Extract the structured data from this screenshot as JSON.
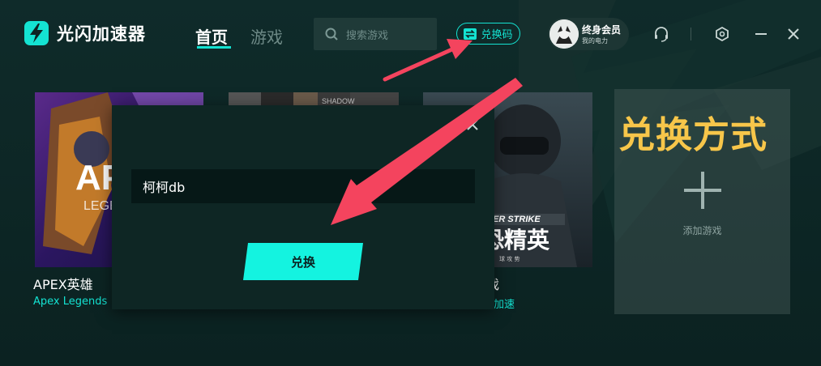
{
  "app": {
    "name": "光闪加速器"
  },
  "nav": {
    "tabs": [
      {
        "label": "首页",
        "active": true
      },
      {
        "label": "游戏",
        "active": false
      }
    ]
  },
  "search": {
    "placeholder": "搜索游戏"
  },
  "redeem": {
    "label": "兑换码"
  },
  "member": {
    "title": "终身会员",
    "subtitle": "我的电力"
  },
  "window_controls": [
    "headset-icon",
    "settings-icon",
    "minimize-icon",
    "close-icon"
  ],
  "games": [
    {
      "title": "APEX英雄",
      "subtitle": "Apex Legends"
    },
    {
      "title": "",
      "subtitle": ""
    },
    {
      "title": "反恐精英",
      "title_visible": "反恐精英",
      "subtitle_visible": "加速"
    }
  ],
  "game_art_text": {
    "apex": "APE",
    "apex_sub": "LEGE",
    "shadow": "SHADOW",
    "cs_banner": "ER STRIKE",
    "cs_cn": "恐精英",
    "cs_small": "球   攻   势"
  },
  "partial_labels": {
    "third_title_fragment": "戏",
    "third_sub_fragment": "加速"
  },
  "add_game": {
    "label": "添加游戏"
  },
  "overlay": {
    "text": "兑换方式"
  },
  "modal": {
    "input_value": "柯柯db",
    "submit_label": "兑换"
  },
  "colors": {
    "accent": "#14e3d2",
    "background": "#0d2423",
    "overlay_text": "#f7c64a",
    "arrow": "#f4445e"
  }
}
